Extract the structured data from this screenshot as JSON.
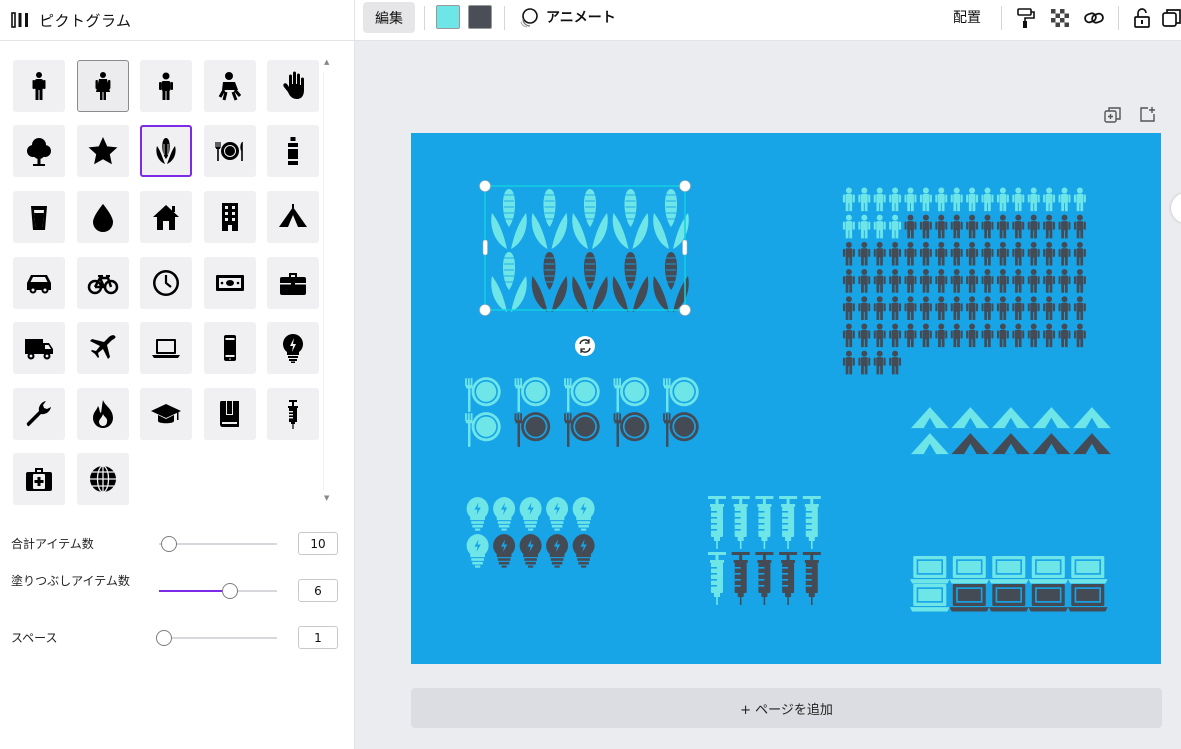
{
  "panel": {
    "title": "ピクトグラム",
    "tiles": [
      "person-icon",
      "woman-icon",
      "child-icon",
      "baby-icon",
      "hand-icon",
      "tree-icon",
      "star-icon",
      "corn-icon",
      "plate-cutlery-icon",
      "bottle-icon",
      "glass-icon",
      "water-drop-icon",
      "house-icon",
      "building-icon",
      "tent-icon",
      "car-icon",
      "bicycle-icon",
      "clock-icon",
      "banknote-icon",
      "briefcase-icon",
      "truck-icon",
      "airplane-icon",
      "laptop-icon",
      "smartphone-icon",
      "lightbulb-icon",
      "wrench-icon",
      "flame-icon",
      "graduation-cap-icon",
      "book-icon",
      "syringe-icon",
      "medical-kit-icon",
      "globe-icon"
    ],
    "selected_tile": "corn-icon",
    "highlighted_tile": "woman-icon",
    "sliders": [
      {
        "label": "合計アイテム数",
        "value": "10",
        "level": 0.08
      },
      {
        "label": "塗りつぶしアイテム数",
        "value": "6",
        "level": 0.6
      },
      {
        "label": "スペース",
        "value": "1",
        "level": 0.04
      }
    ]
  },
  "toolbar": {
    "edit_label": "編集",
    "colors": [
      "#6ee6e8",
      "#4a4f57"
    ],
    "animate_label": "アニメート",
    "arrange_label": "配置",
    "right_icons": [
      "paint-roller-icon",
      "transparency-icon",
      "link-icon",
      "lock-icon",
      "duplicate-icon"
    ]
  },
  "canvas": {
    "background": "#18a5e8",
    "light_color": "#6ee6e8",
    "dark_color": "#454b55",
    "add_page_label": "+ ページを追加",
    "graphics": [
      {
        "icon": "corn",
        "total": 10,
        "filled": 6,
        "selected": true
      },
      {
        "icon": "person",
        "total": 100,
        "filled": 20
      },
      {
        "icon": "plate",
        "total": 10,
        "filled": 6
      },
      {
        "icon": "tent",
        "total": 10,
        "filled": 6
      },
      {
        "icon": "lightbulb",
        "total": 10,
        "filled": 6
      },
      {
        "icon": "syringe",
        "total": 10,
        "filled": 6
      },
      {
        "icon": "laptop",
        "total": 10,
        "filled": 6
      }
    ]
  }
}
